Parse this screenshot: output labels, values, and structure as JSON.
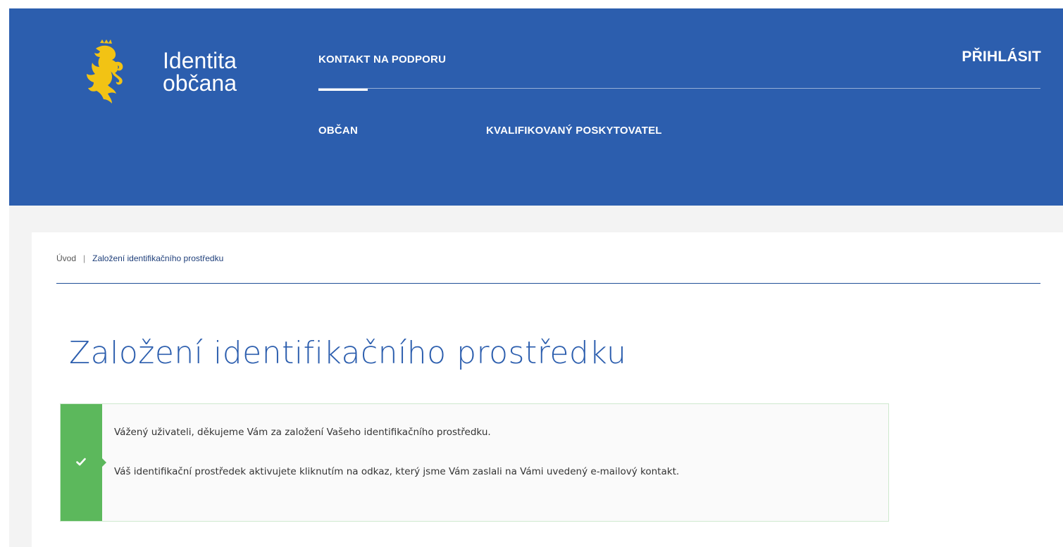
{
  "header": {
    "brand_line1": "Identita",
    "brand_line2": "občana",
    "nav_top": "KONTAKT NA PODPORU",
    "login": "PŘIHLÁSIT",
    "nav_sub": [
      "OBČAN",
      "KVALIFIKOVANÝ POSKYTOVATEL"
    ],
    "logo_icon": "czech-lion-coat-of-arms",
    "colors": {
      "header_bg": "#2c5eae",
      "logo": "#f2c314"
    }
  },
  "breadcrumb": {
    "home": "Úvod",
    "separator": "|",
    "current": "Založení identifikačního prostředku"
  },
  "main": {
    "title": "Založení identifikačního prostředku"
  },
  "alert": {
    "type": "success",
    "icon": "check-icon",
    "color": "#5cb85c",
    "line1": "Vážený uživateli, děkujeme Vám za založení Vašeho identifikačního prostředku.",
    "line2": "Váš identifikační prostředek aktivujete kliknutím na odkaz, který jsme Vám zaslali na Vámi uvedený e-mailový kontakt."
  }
}
